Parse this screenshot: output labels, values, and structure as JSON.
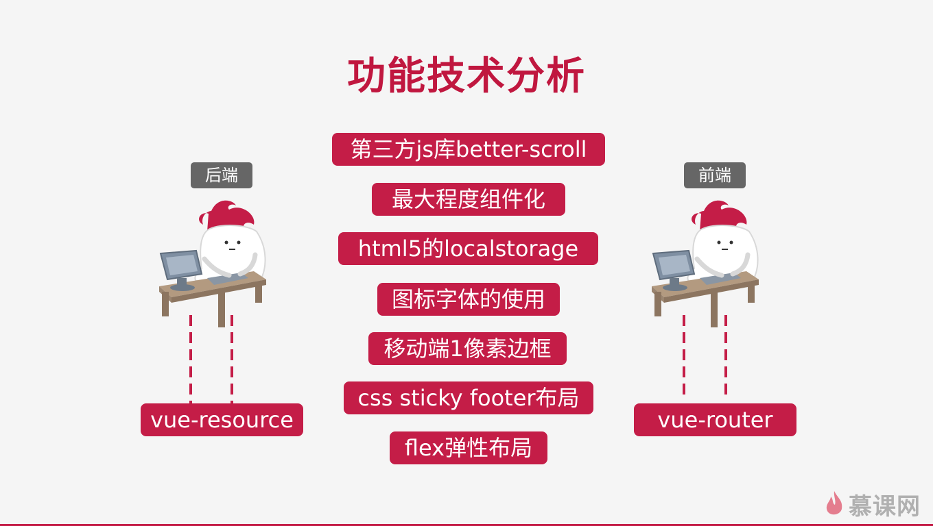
{
  "title": "功能技术分析",
  "features": [
    "第三方js库better-scroll",
    "最大程度组件化",
    "html5的localstorage",
    "图标字体的使用",
    "移动端1像素边框",
    "css sticky footer布局",
    "flex弹性布局"
  ],
  "left": {
    "tag": "后端",
    "label": "vue-resource"
  },
  "right": {
    "tag": "前端",
    "label": "vue-router"
  },
  "logo": {
    "text": "慕课网",
    "icon": "flame-icon"
  },
  "colors": {
    "accent": "#c41d47",
    "title": "#c0173f",
    "tag": "#666666",
    "background": "#f5f5f5"
  }
}
